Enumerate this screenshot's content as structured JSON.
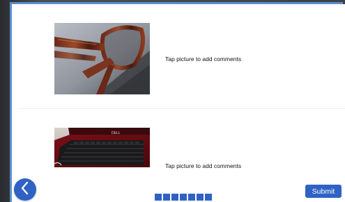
{
  "items": [
    {
      "caption": "Tap picture to add comments",
      "photo_icon": "sunglasses-photo"
    },
    {
      "caption": "Tap picture to add comments",
      "photo_icon": "laptop-photo",
      "brand_text": "DELL"
    }
  ],
  "navigation": {
    "back_icon": "chevron-left-icon",
    "submit_label": "Submit",
    "page_count": 7
  },
  "colors": {
    "accent": "#2f62c5",
    "window_border": "#5a8fd0",
    "background": "#ffffff"
  }
}
